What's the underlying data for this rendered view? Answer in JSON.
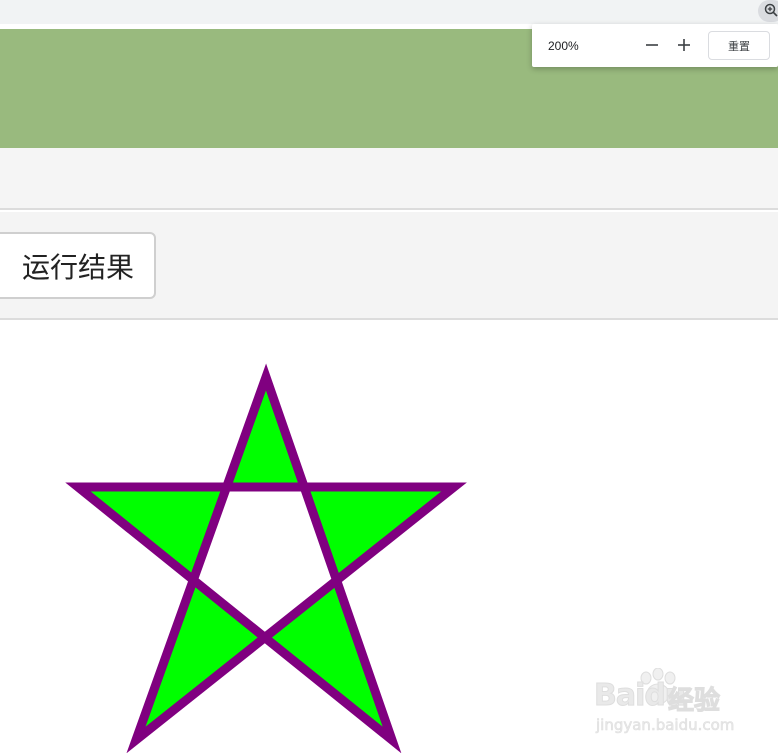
{
  "zoom": {
    "level": "200%",
    "reset_label": "重置",
    "minus_icon": "minus-icon",
    "plus_icon": "plus-icon",
    "indicator_icon": "zoom-in-icon"
  },
  "run_result_label": "运行结果",
  "watermark": {
    "brand": "Baidu",
    "jingyan": "经验",
    "url": "jingyan.baidu.com"
  },
  "colors": {
    "header": "#99ba7e",
    "star_fill": "#00ff00",
    "star_stroke": "#800080"
  }
}
